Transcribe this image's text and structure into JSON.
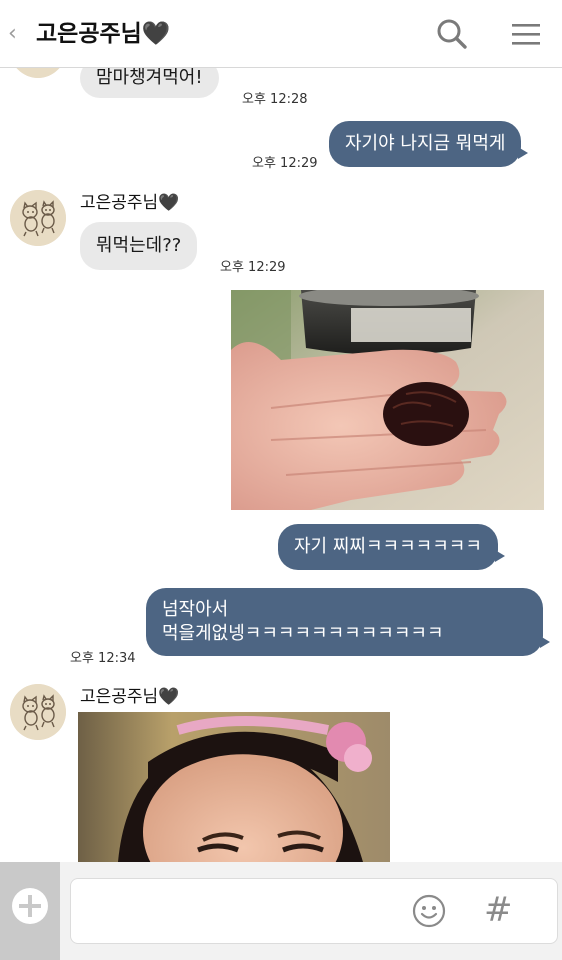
{
  "header": {
    "back": "‹",
    "title": "고은공주님🖤"
  },
  "messages": {
    "m1_text": "맘마챙겨먹어!",
    "m1_time": "오후 12:28",
    "m2_text": "자기야 나지금 뭐먹게",
    "m2_time": "오후 12:29",
    "m3_name": "고은공주님🖤",
    "m3_text": "뭐먹는데??",
    "m3_time": "오후 12:29",
    "m5_text": "자기 찌찌ㅋㅋㅋㅋㅋㅋㅋ",
    "m6_line1": "넘작아서",
    "m6_line2": "먹을게없넹ㅋㅋㅋㅋㅋㅋㅋㅋㅋㅋㅋㅋ",
    "m6_time": "오후 12:34",
    "m7_name": "고은공주님🖤"
  },
  "composer": {
    "input_value": "",
    "hash": "#"
  },
  "colors": {
    "outgoing_bubble": "#4d6583",
    "incoming_bubble": "#e9e9e9",
    "avatar_bg": "#e8dcc4"
  },
  "icons": [
    "back-chevron-icon",
    "search-icon",
    "menu-icon",
    "cat-avatar-icon",
    "plus-icon",
    "emoji-icon",
    "hash-icon"
  ]
}
